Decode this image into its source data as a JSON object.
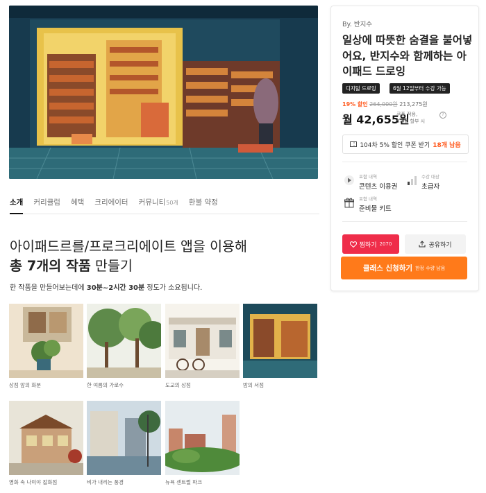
{
  "tabs": [
    {
      "label": "소개"
    },
    {
      "label": "커리큘럼"
    },
    {
      "label": "혜택"
    },
    {
      "label": "크리에이터"
    },
    {
      "label": "커뮤니티",
      "count": "50개"
    },
    {
      "label": "환불 약정"
    }
  ],
  "headline": {
    "line1": "아이패드르를/프로크리에이트 앱을 이용해",
    "line2_bold": "총 7개의 작품",
    "line2_rest": " 만들기"
  },
  "subtext": {
    "prefix": "한 작품을 만들어보는데에 ",
    "bold": "30분~2시간 30분",
    "suffix": " 정도가 소요됩니다."
  },
  "works": [
    {
      "caption": "상점 앞의 화분"
    },
    {
      "caption": "한 여름의 가로수"
    },
    {
      "caption": "도교의 상점"
    },
    {
      "caption": "밤의 서점"
    },
    {
      "caption": "영화 속 나미야 잡화점"
    },
    {
      "caption": "비가 내리는 풍경"
    },
    {
      "caption": "뉴욕 센트럴 파크"
    }
  ],
  "panel": {
    "by": "By. 반지수",
    "title": "일상에 따뜻한 숨결을 불어넣어요, 반지수와 함께하는 아이패드 드로잉",
    "badges": [
      "디지털 드로잉",
      "6월 12일부터 수강 가능"
    ],
    "discount_pct": "19% 할인",
    "old_price": "264,000원",
    "discount_amount": "213,275원",
    "monthly_price": "월 42,655원",
    "installment_line1": "쿠폰 적용,",
    "installment_line2": "5개월 할부 시",
    "info_mark": "?",
    "coupon_text": "104차 5% 할인 쿠폰 받기",
    "coupon_left": "18개 남음",
    "content_label": "포함 내역",
    "content_value": "콘텐츠 이용권",
    "target_label": "수강 대상",
    "target_value": "초급자",
    "kit_label": "포함 내역",
    "kit_value": "준비물 키트",
    "like_label": "찜하기",
    "like_count": "2070",
    "share_label": "공유하기",
    "apply_label": "클래스 신청하기",
    "apply_left": "한정 수량 남음"
  },
  "colors": {
    "accent_orange": "#ff7a1a",
    "discount_orange": "#ff5a1f",
    "like_red": "#ef2d4a"
  },
  "icons": [
    "ticket-icon",
    "play-icon",
    "bar-level-icon",
    "gift-icon",
    "heart-icon",
    "share-icon"
  ]
}
